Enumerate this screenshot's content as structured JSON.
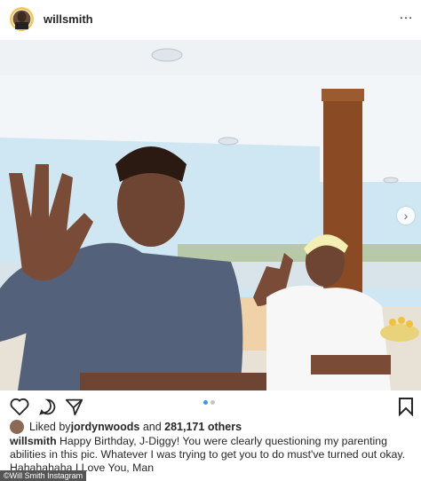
{
  "post": {
    "username": "willsmith",
    "menu_glyph": "…"
  },
  "actions": {
    "like_icon": "heart-icon",
    "comment_icon": "comment-icon",
    "share_icon": "send-icon",
    "save_icon": "bookmark-icon"
  },
  "carousel": {
    "current": 1,
    "total": 2
  },
  "likes": {
    "prefix": "Liked by ",
    "user": "jordynwoods",
    "mid": " and ",
    "count": "281,171 others"
  },
  "caption": {
    "username": "willsmith",
    "text": " Happy Birthday, J-Diggy! You were clearly questioning my parenting abilities in this pic. Whatever I was trying to get you to do must've turned out okay. Hahahahaha I Love You, Man"
  },
  "credit": "©Will Smith Instagram",
  "colors": {
    "accent": "#3897f0",
    "text": "#262626"
  }
}
